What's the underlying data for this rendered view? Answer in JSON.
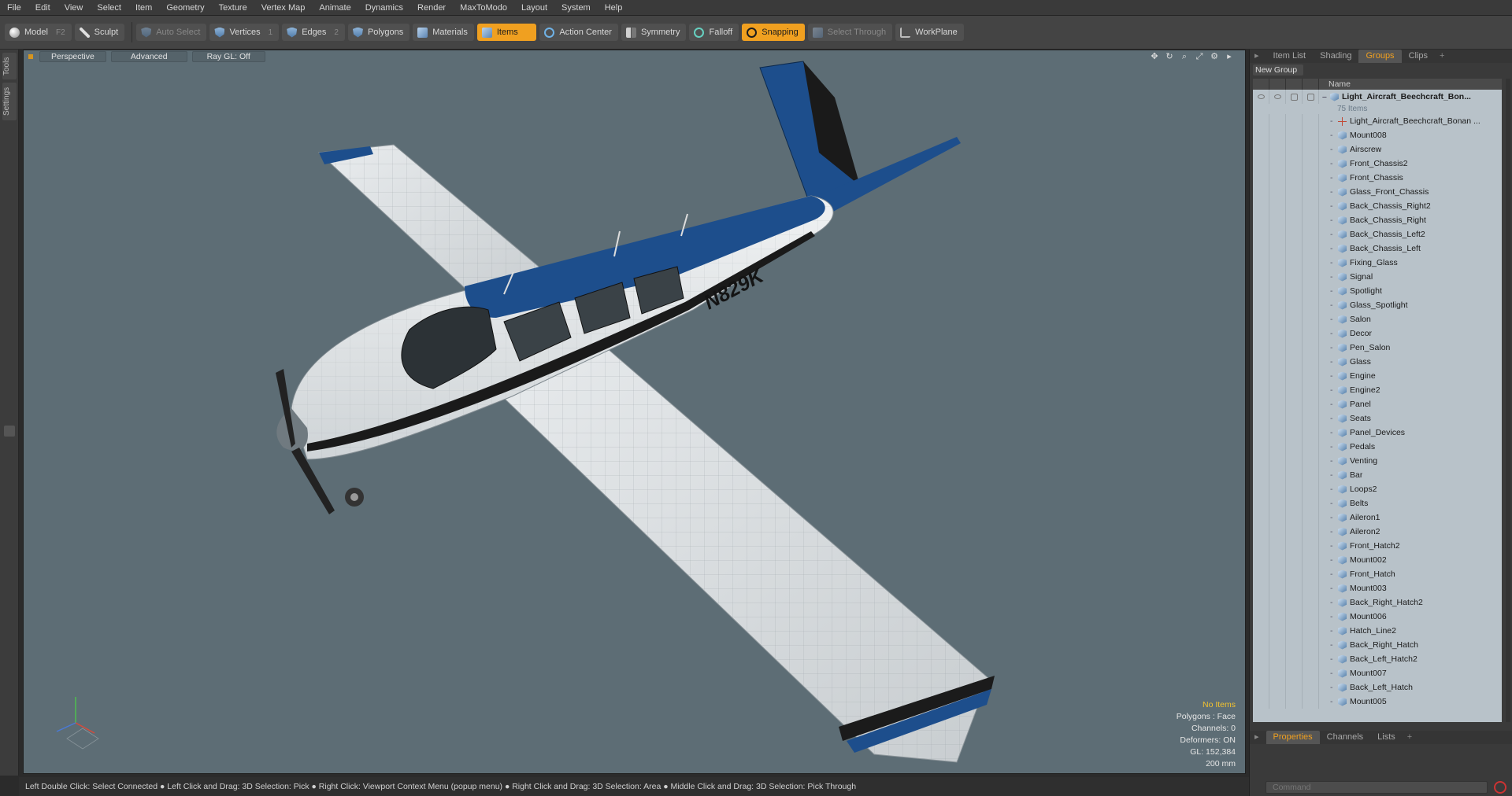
{
  "menu": [
    "File",
    "Edit",
    "View",
    "Select",
    "Item",
    "Geometry",
    "Texture",
    "Vertex Map",
    "Animate",
    "Dynamics",
    "Render",
    "MaxToModo",
    "Layout",
    "System",
    "Help"
  ],
  "toolbar": {
    "model": {
      "label": "Model",
      "key": "F2"
    },
    "sculpt": {
      "label": "Sculpt"
    },
    "auto_select": {
      "label": "Auto Select"
    },
    "vertices": {
      "label": "Vertices",
      "key": "1"
    },
    "edges": {
      "label": "Edges",
      "key": "2"
    },
    "polygons": {
      "label": "Polygons"
    },
    "materials": {
      "label": "Materials"
    },
    "items": {
      "label": "Items"
    },
    "action_center": {
      "label": "Action Center"
    },
    "symmetry": {
      "label": "Symmetry"
    },
    "falloff": {
      "label": "Falloff"
    },
    "snapping": {
      "label": "Snapping"
    },
    "select_through": {
      "label": "Select Through"
    },
    "workplane": {
      "label": "WorkPlane"
    }
  },
  "left_tabs": [
    "Tools",
    "Settings"
  ],
  "viewport": {
    "view": "Perspective",
    "shading": "Advanced",
    "raygl": "Ray GL: Off",
    "tail_number": "N829K",
    "stats": {
      "selection": "No Items",
      "polygons": "Polygons : Face",
      "channels": "Channels: 0",
      "deformers": "Deformers: ON",
      "gl": "GL: 152,384",
      "units": "200 mm"
    }
  },
  "right_panel": {
    "tabs": [
      "Item List",
      "Shading",
      "Groups",
      "Clips"
    ],
    "active_tab": "Groups",
    "new_group": "New Group",
    "name_header": "Name",
    "root": {
      "name": "Light_Aircraft_Beechcraft_Bon...",
      "count": "75 Items"
    },
    "items": [
      "Light_Aircraft_Beechcraft_Bonan ...",
      "Mount008",
      "Airscrew",
      "Front_Chassis2",
      "Front_Chassis",
      "Glass_Front_Chassis",
      "Back_Chassis_Right2",
      "Back_Chassis_Right",
      "Back_Chassis_Left2",
      "Back_Chassis_Left",
      "Fixing_Glass",
      "Signal",
      "Spotlight",
      "Glass_Spotlight",
      "Salon",
      "Decor",
      "Pen_Salon",
      "Glass",
      "Engine",
      "Engine2",
      "Panel",
      "Seats",
      "Panel_Devices",
      "Pedals",
      "Venting",
      "Bar",
      "Loops2",
      "Belts",
      "Aileron1",
      "Aileron2",
      "Front_Hatch2",
      "Mount002",
      "Front_Hatch",
      "Mount003",
      "Back_Right_Hatch2",
      "Mount006",
      "Hatch_Line2",
      "Back_Right_Hatch",
      "Back_Left_Hatch2",
      "Mount007",
      "Back_Left_Hatch",
      "Mount005"
    ],
    "bottom_tabs": [
      "Properties",
      "Channels",
      "Lists"
    ],
    "command_placeholder": "Command"
  },
  "status_bar": "Left Double Click: Select Connected ● Left Click and Drag: 3D Selection: Pick ● Right Click: Viewport Context Menu (popup menu) ● Right Click and Drag: 3D Selection: Area ● Middle Click and Drag: 3D Selection: Pick Through",
  "colors": {
    "accent": "#f0a020",
    "viewport_bg": "#5d6d75",
    "livery_blue": "#1d4e8c"
  }
}
